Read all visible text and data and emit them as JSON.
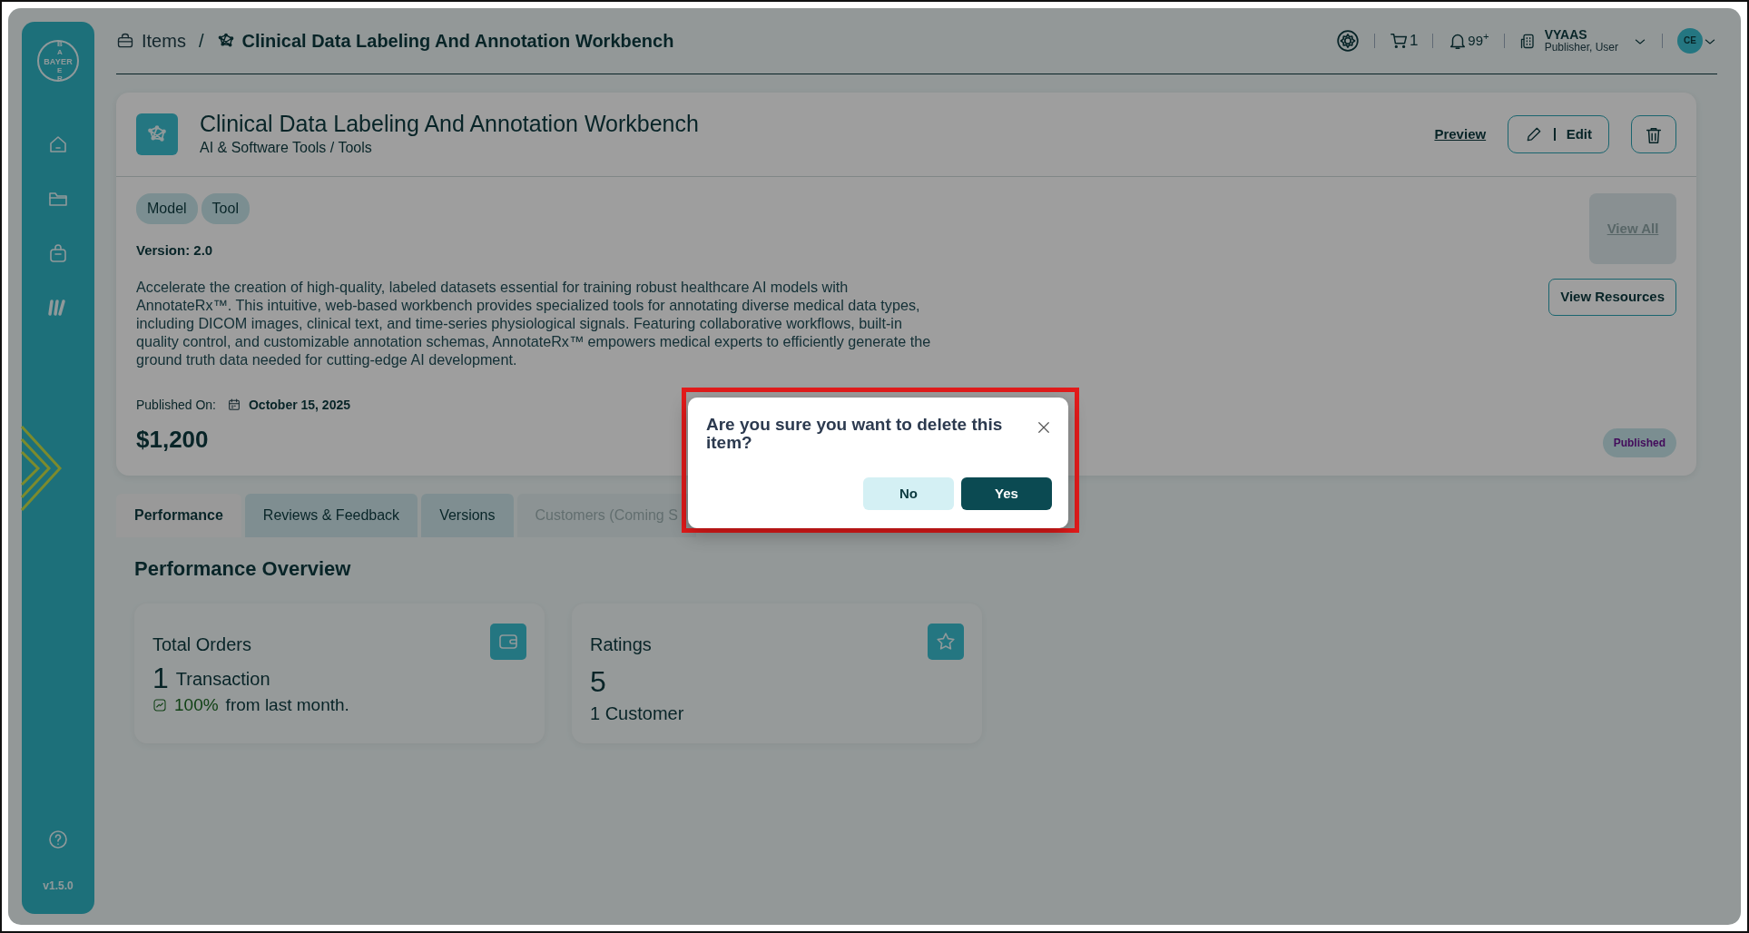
{
  "sidebar": {
    "logo_horizontal": "BAYER",
    "logo_vertical_top": "BA",
    "logo_vertical_bottom": "ER",
    "version": "v1.5.0"
  },
  "breadcrumb_separator": "/",
  "breadcrumb": [
    {
      "label": "Items",
      "current": false
    },
    {
      "label": "Clinical Data Labeling And Annotation Workbench",
      "current": true
    }
  ],
  "header": {
    "cart_count": "1",
    "notifications": "99$^{+}$",
    "org_name": "VYAAS",
    "org_role": "Publisher, User",
    "avatar": "CE"
  },
  "product": {
    "title": "Clinical Data Labeling And Annotation Workbench",
    "category": "AI & Software Tools / Tools",
    "preview": "Preview",
    "edit": "Edit",
    "tags": [
      "Model",
      "Tool"
    ],
    "version": "Version: 2.0",
    "description": "Accelerate the creation of high-quality, labeled datasets essential for training robust healthcare AI models with AnnotateRx™. This intuitive, web-based workbench provides specialized tools for annotating diverse medical data types, including DICOM images, clinical text, and time-series physiological signals. Featuring collaborative workflows, built-in quality control, and customizable annotation schemas, AnnotateRx™ empowers medical experts to efficiently generate the ground truth data needed for cutting-edge AI development.",
    "published_label": "Published On:",
    "published_date": "October 15, 2025",
    "price": "$1,200",
    "view_all": {
      "label": "View All",
      "disabled": true
    },
    "view_resources": "View Resources",
    "status": "Published"
  },
  "tabs": [
    {
      "label": "Performance",
      "selected": true,
      "disabled": false
    },
    {
      "label": "Reviews & Feedback",
      "selected": false,
      "disabled": false
    },
    {
      "label": "Versions",
      "selected": false,
      "disabled": false
    },
    {
      "label": "Customers (Coming S",
      "selected": false,
      "disabled": true
    }
  ],
  "section_title": "Performance Overview",
  "stats": [
    {
      "kind": "orders",
      "title": "Total Orders",
      "value": "1",
      "unit": "Transaction",
      "change": "100%",
      "change_text": "from last month."
    },
    {
      "kind": "ratings",
      "title": "Ratings",
      "value": "5",
      "sub": "1 Customer"
    }
  ],
  "modal": {
    "title": "Are you sure you want to delete this item?",
    "no": "No",
    "yes": "Yes"
  }
}
